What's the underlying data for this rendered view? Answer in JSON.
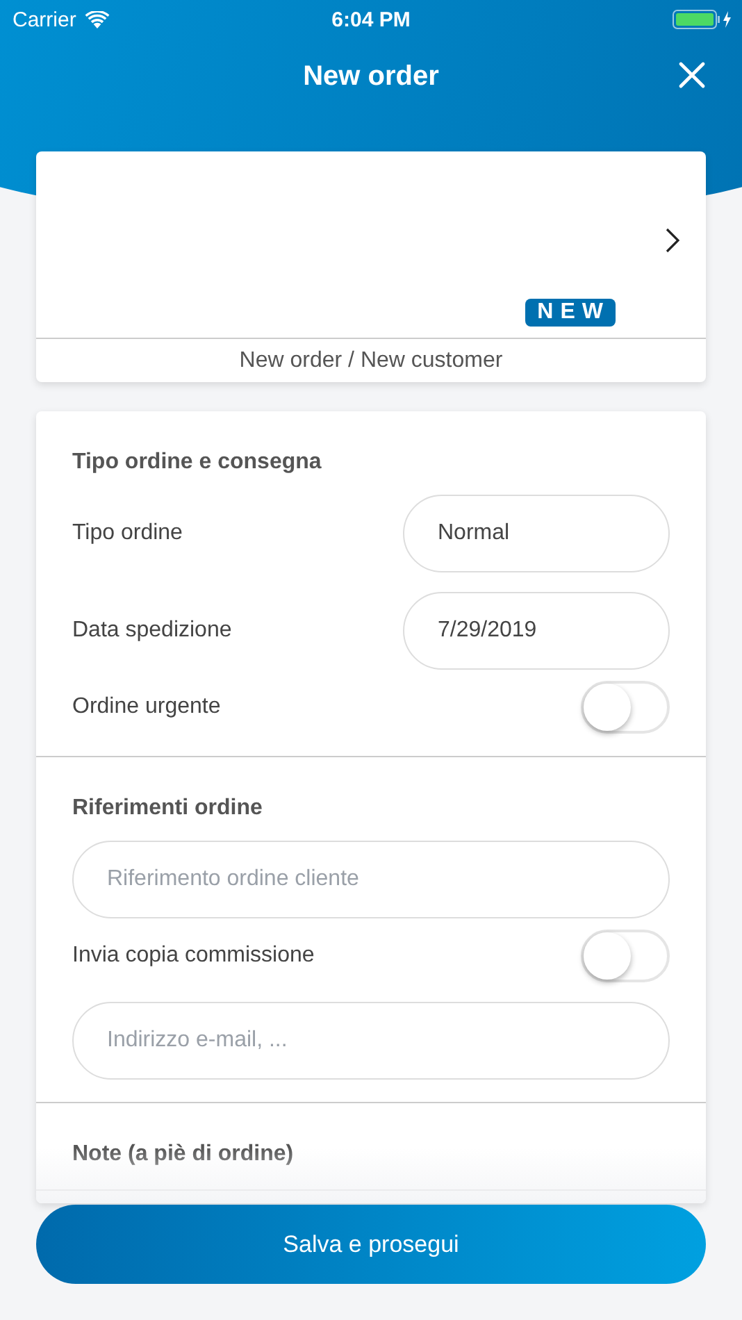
{
  "status_bar": {
    "carrier": "Carrier",
    "time": "6:04 PM"
  },
  "nav": {
    "title": "New order"
  },
  "customer_card": {
    "badge": "NEW",
    "caption": "New order / New customer"
  },
  "sections": [
    {
      "title": "Tipo ordine e consegna",
      "rows": [
        {
          "kind": "select",
          "label": "Tipo ordine",
          "value": "Normal"
        },
        {
          "kind": "select",
          "label": "Data spedizione",
          "value": "7/29/2019"
        },
        {
          "kind": "toggle",
          "label": "Ordine urgente",
          "on": false
        }
      ]
    },
    {
      "title": "Riferimenti ordine",
      "rows": [
        {
          "kind": "input",
          "placeholder": "Riferimento ordine cliente"
        },
        {
          "kind": "toggle",
          "label": "Invia copia commissione",
          "on": false
        },
        {
          "kind": "input",
          "placeholder": "Indirizzo e-mail, ..."
        }
      ]
    },
    {
      "title": "Note (a piè di ordine)"
    }
  ],
  "save_button": "Salva e prosegui"
}
